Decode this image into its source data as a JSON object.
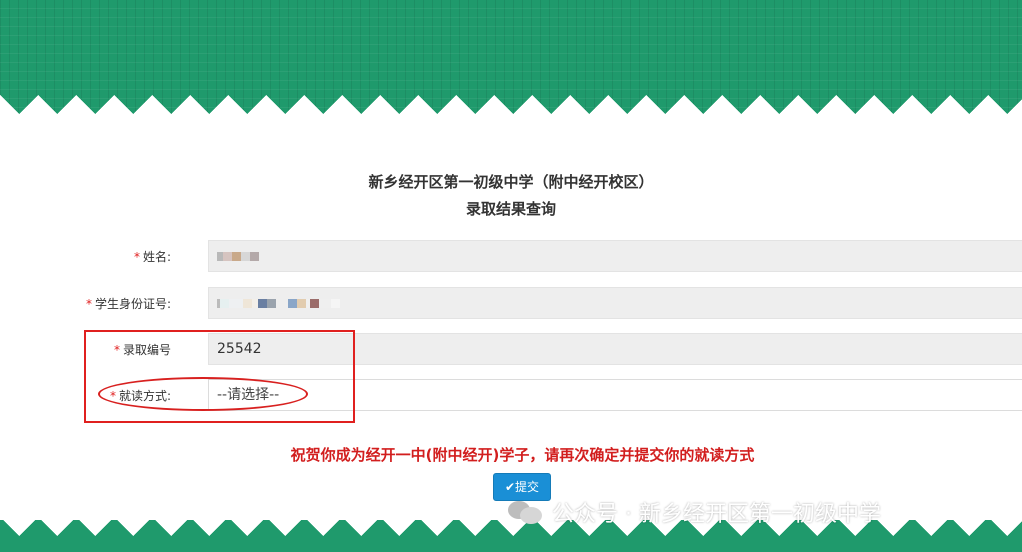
{
  "header": {
    "school_name": "新乡经开区第一初级中学（附中经开校区）",
    "page_title": "录取结果查询"
  },
  "form": {
    "name_label": "姓名:",
    "id_label": "学生身份证号:",
    "admission_label": "录取编号",
    "admission_value": "25542",
    "mode_label": "就读方式:",
    "mode_placeholder": "--请选择--"
  },
  "message": "祝贺你成为经开一中(附中经开)学子，请再次确定并提交你的就读方式",
  "submit_label": "提交",
  "watermark": "公众号 · 新乡经开区第一初级中学",
  "colors": {
    "banner_green": "#1f9a6c",
    "required_red": "#e02020",
    "submit_blue": "#1a8fd6"
  }
}
